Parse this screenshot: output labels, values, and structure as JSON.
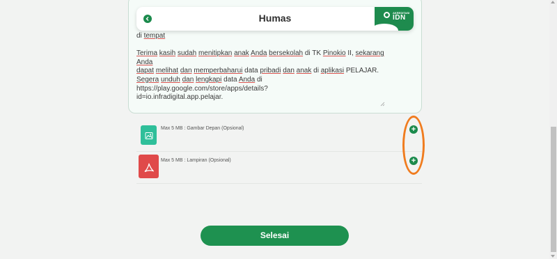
{
  "header": {
    "title": "Humas",
    "brand_small": "AKREDITASI",
    "brand_big": "IDN"
  },
  "message": {
    "line0_a": "di ",
    "line0_b": "tempat",
    "p1_l1": [
      {
        "t": "Terima",
        "u": true
      },
      {
        "t": " ",
        "u": false
      },
      {
        "t": "kasih",
        "u": true
      },
      {
        "t": " ",
        "u": false
      },
      {
        "t": "sudah",
        "u": true
      },
      {
        "t": " ",
        "u": false
      },
      {
        "t": "menitipkan",
        "u": true
      },
      {
        "t": " ",
        "u": false
      },
      {
        "t": "anak",
        "u": true
      },
      {
        "t": " ",
        "u": false
      },
      {
        "t": "Anda",
        "u": true
      },
      {
        "t": " ",
        "u": false
      },
      {
        "t": "bersekolah",
        "u": true
      },
      {
        "t": " di TK ",
        "u": false
      },
      {
        "t": "Pinokio",
        "u": true
      },
      {
        "t": " II, ",
        "u": false
      },
      {
        "t": "sekarang",
        "u": true
      },
      {
        "t": " ",
        "u": false
      },
      {
        "t": "Anda",
        "u": true
      }
    ],
    "p1_l2": [
      {
        "t": "dapat",
        "u": true
      },
      {
        "t": " ",
        "u": false
      },
      {
        "t": "melihat",
        "u": true
      },
      {
        "t": " ",
        "u": false
      },
      {
        "t": "dan",
        "u": true
      },
      {
        "t": " ",
        "u": false
      },
      {
        "t": "memperbaharui",
        "u": true
      },
      {
        "t": " data ",
        "u": false
      },
      {
        "t": "pribadi",
        "u": true
      },
      {
        "t": " ",
        "u": false
      },
      {
        "t": "dan",
        "u": true
      },
      {
        "t": " ",
        "u": false
      },
      {
        "t": "anak",
        "u": true
      },
      {
        "t": " di ",
        "u": false
      },
      {
        "t": "aplikasi",
        "u": true
      },
      {
        "t": " PELAJAR.",
        "u": false
      }
    ],
    "p1_l3": [
      {
        "t": "Segera",
        "u": true
      },
      {
        "t": " ",
        "u": false
      },
      {
        "t": "unduh",
        "u": true
      },
      {
        "t": " ",
        "u": false
      },
      {
        "t": "dan",
        "u": true
      },
      {
        "t": " ",
        "u": false
      },
      {
        "t": "lengkapi",
        "u": true
      },
      {
        "t": " data ",
        "u": false
      },
      {
        "t": "Anda",
        "u": true
      },
      {
        "t": " di https://play.google.com/store/apps/details?",
        "u": false
      }
    ],
    "p1_l4": "id=io.infradigital.app.pelajar."
  },
  "uploads": [
    {
      "label": "Max 5 MB : Gambar Depan (Opsional)",
      "icon": "image-file-icon",
      "color": "#2fbf9a"
    },
    {
      "label": "Max 5 MB : Lampiran (Opsional)",
      "icon": "pdf-file-icon",
      "color": "#e04a4a"
    }
  ],
  "add_symbol": "+",
  "done_label": "Selesai",
  "colors": {
    "primary": "#1e9150",
    "highlight": "#f07c1f",
    "spellcheck_underline": "#d9534f"
  }
}
